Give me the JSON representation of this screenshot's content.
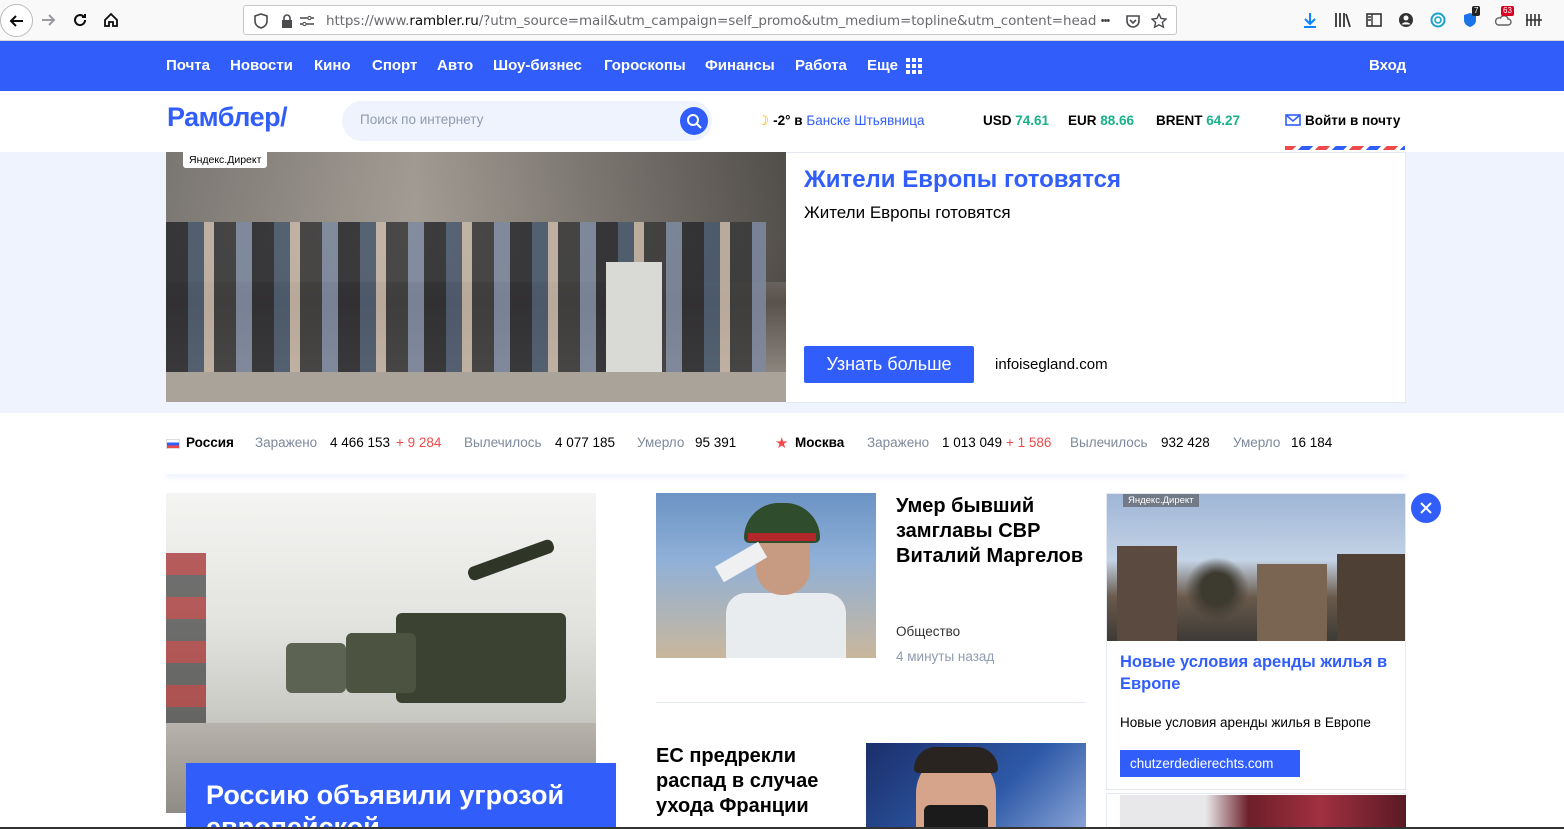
{
  "browser": {
    "url_prefix": "https://www.",
    "url_host": "rambler.ru",
    "url_rest": "/?utm_source=mail&utm_campaign=self_promo&utm_medium=topline&utm_content=head",
    "url_menu_glyph": "•••",
    "badge_a": "7",
    "badge_b": "63"
  },
  "topmenu": {
    "items": [
      "Почта",
      "Новости",
      "Кино",
      "Спорт",
      "Авто",
      "Шоу-бизнес",
      "Гороскопы",
      "Финансы",
      "Работа",
      "Еще"
    ],
    "login": "Вход"
  },
  "header": {
    "logo": "Рамблер/",
    "search_placeholder": "Поиск по интернету",
    "weather_temp": "-2° в",
    "weather_city": "Банске Штьявница",
    "usd_label": "USD",
    "usd_value": "74.61",
    "eur_label": "EUR",
    "eur_value": "88.66",
    "brent_label": "BRENT",
    "brent_value": "64.27",
    "mail_link": "Войти в почту"
  },
  "ad_banner": {
    "label": "Яндекс.Директ",
    "title": "Жители Европы готовятся",
    "subtitle": "Жители Европы готовятся",
    "button": "Узнать больше",
    "domain": "infoisegland.com"
  },
  "covid": {
    "russia": {
      "region": "Россия",
      "infected_label": "Заражено",
      "infected": "4 466 153",
      "infected_delta": "+ 9 284",
      "recovered_label": "Вылечилось",
      "recovered": "4 077 185",
      "died_label": "Умерло",
      "died": "95 391"
    },
    "moscow": {
      "region": "Москва",
      "infected_label": "Заражено",
      "infected": "1 013 049",
      "infected_delta": "+ 1 586",
      "recovered_label": "Вылечилось",
      "recovered": "932 428",
      "died_label": "Умерло",
      "died": "16 184"
    }
  },
  "news": {
    "main_title": "Россию объявили угрозой европейской",
    "item1": {
      "title": "Умер бывший замглавы СВР Виталий Маргелов",
      "category": "Общество",
      "time": "4 минуты назад"
    },
    "item2": {
      "title": "ЕС предрекли распад в случае ухода Франции"
    }
  },
  "right_ad": {
    "label": "Яндекс.Директ",
    "title": "Новые условия аренды жилья в Европе",
    "subtitle": "Новые условия аренды жилья в Европе",
    "button": "chutzerdedierechts.com"
  },
  "colors": {
    "brand_blue": "#315efb",
    "positive_green": "#18b28a",
    "alert_red": "#ef4a4a"
  }
}
